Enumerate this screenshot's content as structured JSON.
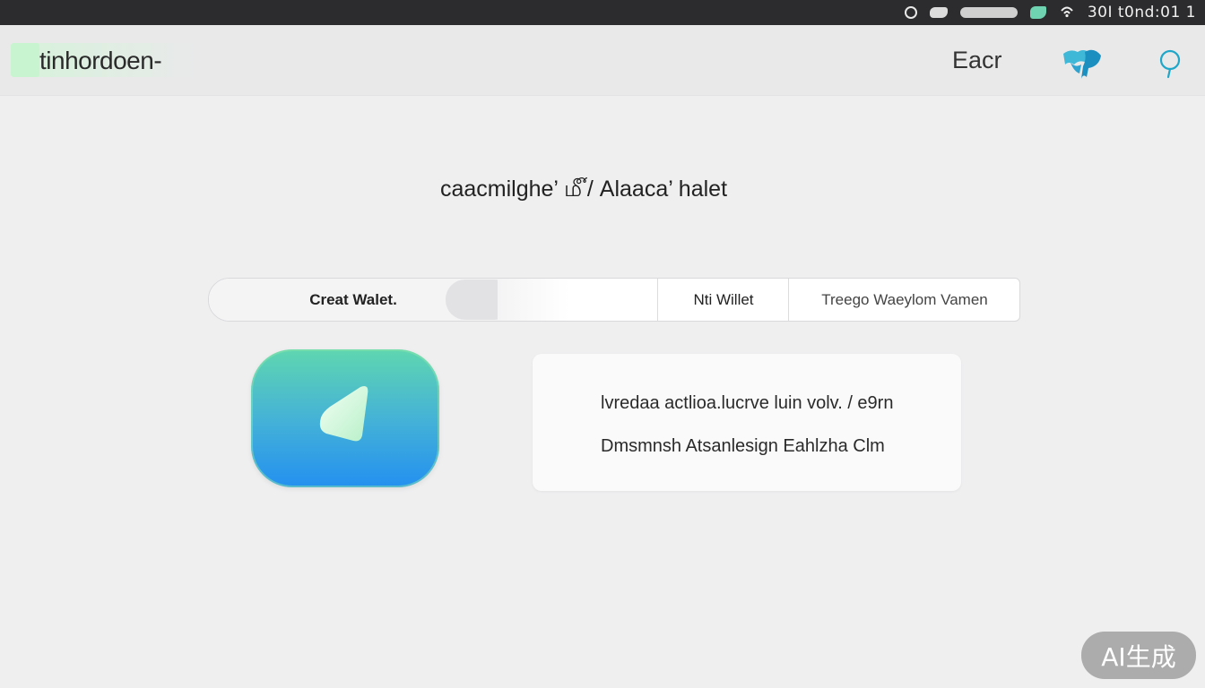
{
  "status_bar": {
    "clock": "30I t0nd:01 1",
    "icons": [
      "search-icon",
      "cloud-icon",
      "network-icon",
      "battery-icon",
      "wifi-icon"
    ]
  },
  "header": {
    "brand": "tinhordoen-",
    "nav_link": "Eacr",
    "icons": [
      "world-map-icon",
      "location-pin-icon"
    ],
    "colors": {
      "accent": "#1fa7c9",
      "logo_mark": "#c8f5cf"
    }
  },
  "main": {
    "heading": "caacmilghe’ ௴/ Alaaca’ halet",
    "tabs": [
      {
        "label": "Creat Walet.",
        "selected": true
      },
      {
        "label": "Nti Willet",
        "selected": false
      },
      {
        "label": "Treego Waeylom Vamen",
        "selected": false
      }
    ],
    "wallet_icon": "wallet-icon",
    "wallet_colors": {
      "top": "#5fd6b0",
      "bottom": "#2490f0"
    },
    "info_lines": [
      "lvredaa actlioa.lucrve luin volv. / e9rn",
      "Dmsmnsh Atsanlesign Eahlzha Clm"
    ]
  },
  "watermark": {
    "label": "AI生成"
  }
}
